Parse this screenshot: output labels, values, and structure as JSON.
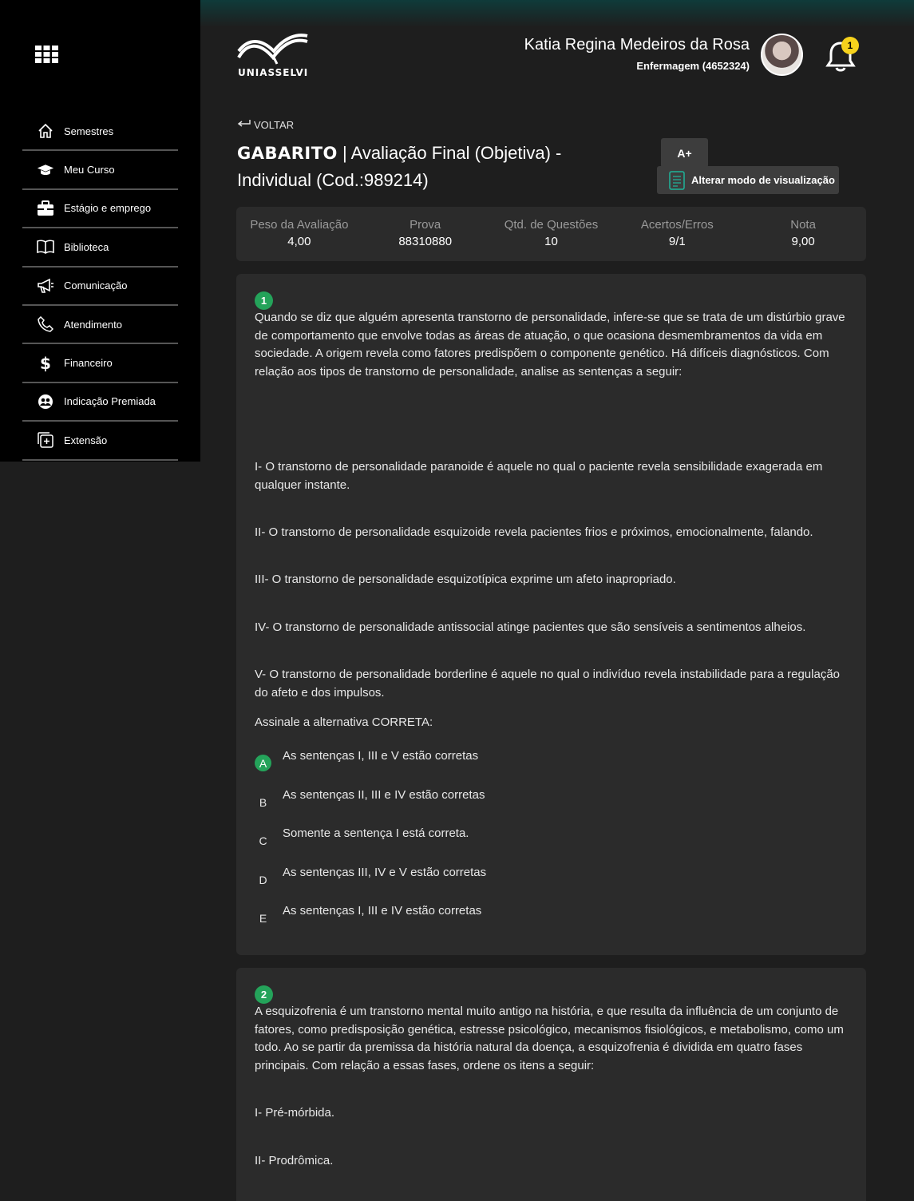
{
  "sidebar": {
    "items": [
      {
        "label": "Semestres",
        "icon": "home-icon"
      },
      {
        "label": "Meu Curso",
        "icon": "graduation-cap-icon"
      },
      {
        "label": "Estágio e emprego",
        "icon": "briefcase-icon"
      },
      {
        "label": "Biblioteca",
        "icon": "book-icon"
      },
      {
        "label": "Comunicação",
        "icon": "megaphone-icon"
      },
      {
        "label": "Atendimento",
        "icon": "phone-icon"
      },
      {
        "label": "Financeiro",
        "icon": "dollar-icon"
      },
      {
        "label": "Indicação Premiada",
        "icon": "people-icon"
      },
      {
        "label": "Extensão",
        "icon": "extension-icon"
      }
    ]
  },
  "header": {
    "logo_text": "UNIASSELVI",
    "user_name": "Katia Regina Medeiros da Rosa",
    "user_course": "Enfermagem (4652324)",
    "notification_count": "1"
  },
  "page": {
    "back_label": "VOLTAR",
    "title_bold": "GABARITO",
    "title_rest": "| Avaliação Final (Objetiva) - Individual (Cod.:989214)",
    "font_button": "A+",
    "view_button": "Alterar modo de visualização"
  },
  "summary": [
    {
      "label": "Peso da Avaliação",
      "value": "4,00"
    },
    {
      "label": "Prova",
      "value": "88310880"
    },
    {
      "label": "Qtd. de Questões",
      "value": "10"
    },
    {
      "label": "Acertos/Erros",
      "value": "9/1"
    },
    {
      "label": "Nota",
      "value": "9,00"
    }
  ],
  "questions": [
    {
      "number": "1",
      "text": "Quando se diz que alguém apresenta transtorno de personalidade, infere-se que se trata de um distúrbio grave de comportamento que envolve todas as áreas de atuação, o que ocasiona desmembramentos da vida em sociedade. A origem revela como fatores predispõem o componente genético. Há difíceis diagnósticos. Com relação aos tipos de transtorno de personalidade, analise as sentenças a seguir:",
      "sentences": [
        "I- O transtorno de personalidade paranoide é aquele no qual o paciente revela sensibilidade exagerada em qualquer instante.",
        "II- O transtorno de personalidade esquizoide revela pacientes frios e próximos, emocionalmente, falando.",
        "III- O transtorno de personalidade esquizotípica exprime um afeto inapropriado.",
        "IV- O transtorno de personalidade antissocial atinge pacientes que são sensíveis a sentimentos alheios.",
        "V- O transtorno de personalidade borderline é aquele no qual o indivíduo revela instabilidade para a regulação do afeto e dos impulsos."
      ],
      "prompt": "Assinale a alternativa CORRETA:",
      "options": [
        {
          "letter": "A",
          "text": "As sentenças I, III e V estão corretas",
          "correct": true
        },
        {
          "letter": "B",
          "text": "As sentenças II, III e IV estão corretas",
          "correct": false
        },
        {
          "letter": "C",
          "text": "Somente a sentença I está correta.",
          "correct": false
        },
        {
          "letter": "D",
          "text": "As sentenças III, IV e V estão corretas",
          "correct": false
        },
        {
          "letter": "E",
          "text": "As sentenças I, III e IV estão corretas",
          "correct": false
        }
      ]
    },
    {
      "number": "2",
      "text": "A esquizofrenia é um transtorno mental muito antigo na história, e que resulta da influência de um conjunto de fatores, como predisposição genética, estresse psicológico, mecanismos fisiológicos, e metabolismo, como um todo. Ao se partir da premissa da história natural da doença, a esquizofrenia é dividida em quatro fases principais. Com relação a essas fases, ordene os itens a seguir:",
      "sentences": [
        "I- Pré-mórbida.",
        "II- Prodrômica."
      ]
    }
  ],
  "colors": {
    "accent_green": "#24a35a",
    "badge_yellow": "#f6d21c",
    "card_bg": "#2b2b2b",
    "page_bg": "#1e1e1e",
    "sidebar_bg": "#000000"
  }
}
